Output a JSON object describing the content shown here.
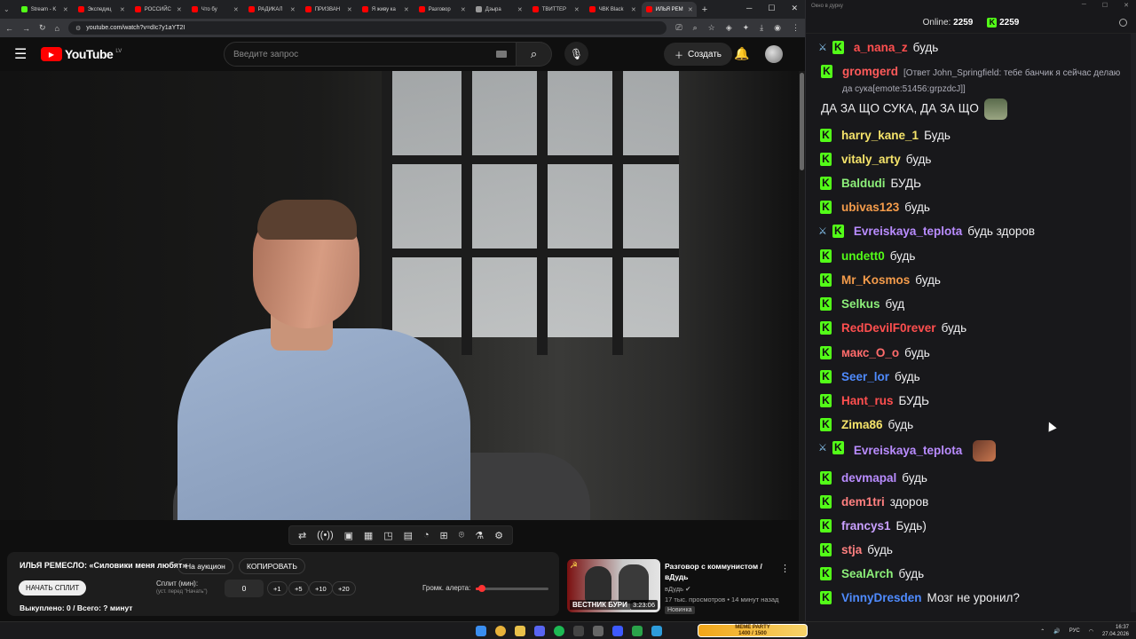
{
  "browser": {
    "tabs": [
      {
        "label": "Stream - K",
        "color": "#53fc18"
      },
      {
        "label": "Экспедиц",
        "color": "#ff0000"
      },
      {
        "label": "РОССИЙС",
        "color": "#ff0000"
      },
      {
        "label": "Что бу",
        "color": "#ff0000"
      },
      {
        "label": "РАДИКАЛ",
        "color": "#ff0000"
      },
      {
        "label": "ПРИЗВАН",
        "color": "#ff0000"
      },
      {
        "label": "Я живу ка",
        "color": "#ff0000"
      },
      {
        "label": "Разговор",
        "color": "#ff0000"
      },
      {
        "label": "Дзыра",
        "color": "#999999"
      },
      {
        "label": "ТВИТТЕР",
        "color": "#ff0000"
      },
      {
        "label": "ЧВК Black",
        "color": "#ff0000"
      },
      {
        "label": "ИЛЬЯ РЕМ",
        "color": "#ff0000",
        "active": true
      }
    ],
    "url": "youtube.com/watch?v=dIc7y1aYT2I"
  },
  "youtube": {
    "logo": "YouTube",
    "region": "LV",
    "search_placeholder": "Введите запрос",
    "create_label": "Создать",
    "video_title": "ИЛЬЯ РЕМЕСЛО: «Силовики меня любят»",
    "auction_label": "На аукцион",
    "copy_label": "КОПИРОВАТЬ",
    "start_split_label": "НАЧАТЬ СПЛИТ",
    "split_label": "Сплит (мин):",
    "split_hint": "(уст. перед \"Начать\")",
    "split_value": "0",
    "steps": [
      "+1",
      "+5",
      "+10",
      "+20"
    ],
    "volume_label": "Громк. алерта:",
    "volume_level": 0.08,
    "bought": "Выкуплено: 0 / Всего: ? минут",
    "recommended": {
      "title": "Разговор с коммунистом / вДудь",
      "channel": "вДудь",
      "meta": "17 тыс. просмотров • 14 минут назад",
      "badge": "Новинка",
      "thumb_caption": "ВЕСТНИК БУРИ",
      "duration": "3:23:06"
    },
    "tools": [
      "loop-icon",
      "broadcast-icon",
      "screenshot-icon",
      "clip-icon",
      "pip-icon",
      "subtitle-icon",
      "speed-icon",
      "add-icon",
      "camera-icon",
      "flask-icon",
      "settings-icon"
    ]
  },
  "chat": {
    "window_title": "Окно в дурку",
    "online_label": "Online:",
    "online_count": "2259",
    "viewers": "2259",
    "messages": [
      {
        "user": "a_nana_z",
        "color": "#ff4f4f",
        "text": "будь",
        "mod": true
      },
      {
        "user": "gromgerd",
        "color": "#ff5a5a",
        "reply": "[Ответ John_Springfield: тебе банчик я сейчас делаю да сука[emote:51456:grpzdcJ]]",
        "text": "ДА ЗА ЩО СУКА, ДА ЗА ЩО",
        "emote": true
      },
      {
        "user": "harry_kane_1",
        "color": "#f5e36a",
        "text": "Будь"
      },
      {
        "user": "vitaly_arty",
        "color": "#f5e36a",
        "text": "будь"
      },
      {
        "user": "Baldudi",
        "color": "#8df07a",
        "text": "БУДЬ"
      },
      {
        "user": "ubivas123",
        "color": "#f59c4b",
        "text": "будь"
      },
      {
        "user": "Evreiskaya_teplota",
        "color": "#b98cff",
        "text": "будь здоров",
        "mod": true
      },
      {
        "user": "undett0",
        "color": "#53fc18",
        "text": "будь"
      },
      {
        "user": "Mr_Kosmos",
        "color": "#f59c4b",
        "text": "будь"
      },
      {
        "user": "Selkus",
        "color": "#8df07a",
        "text": "буд"
      },
      {
        "user": "RedDevilF0rever",
        "color": "#ff4f4f",
        "text": "будь"
      },
      {
        "user": "макс_О_о",
        "color": "#ff6b6b",
        "text": "будь"
      },
      {
        "user": "Seer_lor",
        "color": "#4f8bff",
        "text": "будь"
      },
      {
        "user": "Hant_rus",
        "color": "#ff4f4f",
        "text": "БУДЬ"
      },
      {
        "user": "Zima86",
        "color": "#f5e36a",
        "text": "будь"
      },
      {
        "user": "Evreiskaya_teplota",
        "color": "#b98cff",
        "text": "",
        "mod": true,
        "emote": true
      },
      {
        "user": "devmapal",
        "color": "#b98cff",
        "text": "будь"
      },
      {
        "user": "dem1tri",
        "color": "#ff8080",
        "text": "здоров"
      },
      {
        "user": "francys1",
        "color": "#c9a0ff",
        "text": "Будь)"
      },
      {
        "user": "stja",
        "color": "#ff8080",
        "text": "будь"
      },
      {
        "user": "SealArch",
        "color": "#8df07a",
        "text": "будь"
      },
      {
        "user": "VinnyDresden",
        "color": "#4f8bff",
        "text": "Мозг не уронил?"
      }
    ]
  },
  "taskbar": {
    "meme_title": "MEME PARTY",
    "meme_progress": "1400 / 1500",
    "lang": "РУС",
    "time": "16:37",
    "date": "27.04.2026"
  }
}
